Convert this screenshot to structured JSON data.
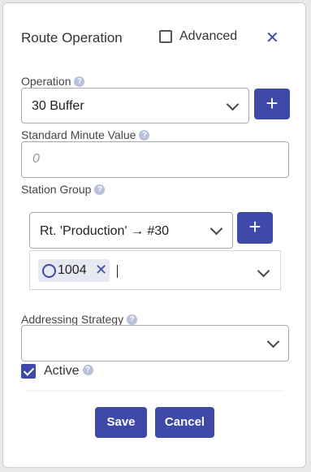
{
  "dialog": {
    "title": "Route Operation",
    "advanced_label": "Advanced",
    "close_glyph": "✕"
  },
  "operation": {
    "label": "Operation",
    "value": "30 Buffer",
    "add_glyph": "+"
  },
  "smv": {
    "label": "Standard Minute Value",
    "placeholder": "0"
  },
  "station_group": {
    "label": "Station Group",
    "value": "Rt. 'Production' → #30",
    "add_glyph": "+",
    "chips": [
      {
        "text": "1004",
        "remove_glyph": "✕"
      }
    ]
  },
  "addressing": {
    "label": "Addressing Strategy",
    "value": ""
  },
  "active": {
    "label": "Active",
    "checked": true
  },
  "footer": {
    "save": "Save",
    "cancel": "Cancel"
  },
  "help_glyph": "?",
  "colors": {
    "accent": "#3f4aa8",
    "chip_bg": "#e6e8f2",
    "help_icon": "#b9c0da"
  }
}
